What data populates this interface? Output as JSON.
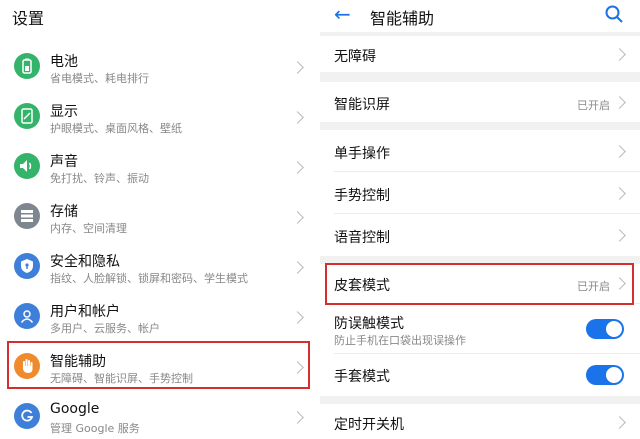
{
  "left": {
    "title": "设置",
    "items": [
      {
        "name": "电池",
        "sub": "省电模式、耗电排行",
        "icon": "battery-icon",
        "color": "#34b36b"
      },
      {
        "name": "显示",
        "sub": "护眼模式、桌面风格、壁纸",
        "icon": "display-icon",
        "color": "#34b36b"
      },
      {
        "name": "声音",
        "sub": "免打扰、铃声、振动",
        "icon": "sound-icon",
        "color": "#34b36b"
      },
      {
        "name": "存储",
        "sub": "内存、空间清理",
        "icon": "storage-icon",
        "color": "#7e8690"
      },
      {
        "name": "安全和隐私",
        "sub": "指纹、人脸解锁、锁屏和密码、学生模式",
        "icon": "shield-icon",
        "color": "#3d7fd9"
      },
      {
        "name": "用户和帐户",
        "sub": "多用户、云服务、帐户",
        "icon": "user-icon",
        "color": "#3d7fd9"
      },
      {
        "name": "智能辅助",
        "sub": "无障碍、智能识屏、手势控制",
        "icon": "hand-icon",
        "color": "#f08b2d"
      },
      {
        "name": "Google",
        "sub": "管理 Google 服务",
        "icon": "google-icon",
        "color": "#3d7fd9"
      }
    ]
  },
  "right": {
    "title": "智能辅助",
    "items": [
      {
        "name": "无障碍"
      },
      {
        "name": "智能识屏",
        "value": "已开启"
      },
      {
        "name": "单手操作"
      },
      {
        "name": "手势控制"
      },
      {
        "name": "语音控制"
      },
      {
        "name": "皮套模式",
        "value": "已开启"
      },
      {
        "name": "防误触模式",
        "sub": "防止手机在口袋出现误操作",
        "toggle": true
      },
      {
        "name": "手套模式",
        "toggle": true
      },
      {
        "name": "定时开关机"
      }
    ]
  },
  "colors": {
    "accent": "#1a73e8",
    "highlight": "#d32f2f"
  }
}
